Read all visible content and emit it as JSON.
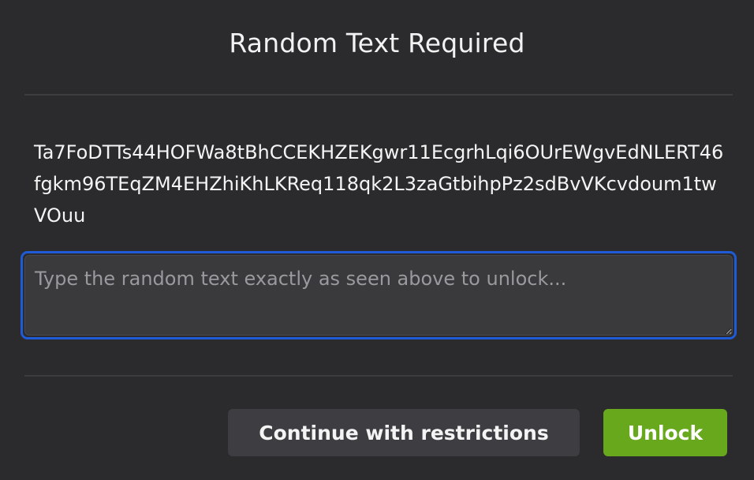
{
  "dialog": {
    "title": "Random Text Required",
    "random_text": "Ta7FoDTTs44HOFWa8tBhCCEKHZEKgwr11EcgrhLqi6OUrEWgvEdNLERT46fgkm96TEqZM4EHZhiKhLKReq118qk2L3zaGtbihpPz2sdBvVKcvdoum1twVOuu",
    "input": {
      "value": "",
      "placeholder": "Type the random text exactly as seen above to unlock..."
    },
    "buttons": {
      "continue_label": "Continue with restrictions",
      "unlock_label": "Unlock"
    }
  },
  "colors": {
    "background": "#2b2b2d",
    "focus_ring": "#1f5bd6",
    "primary_button": "#68a81d",
    "secondary_button": "#3e3e42"
  }
}
